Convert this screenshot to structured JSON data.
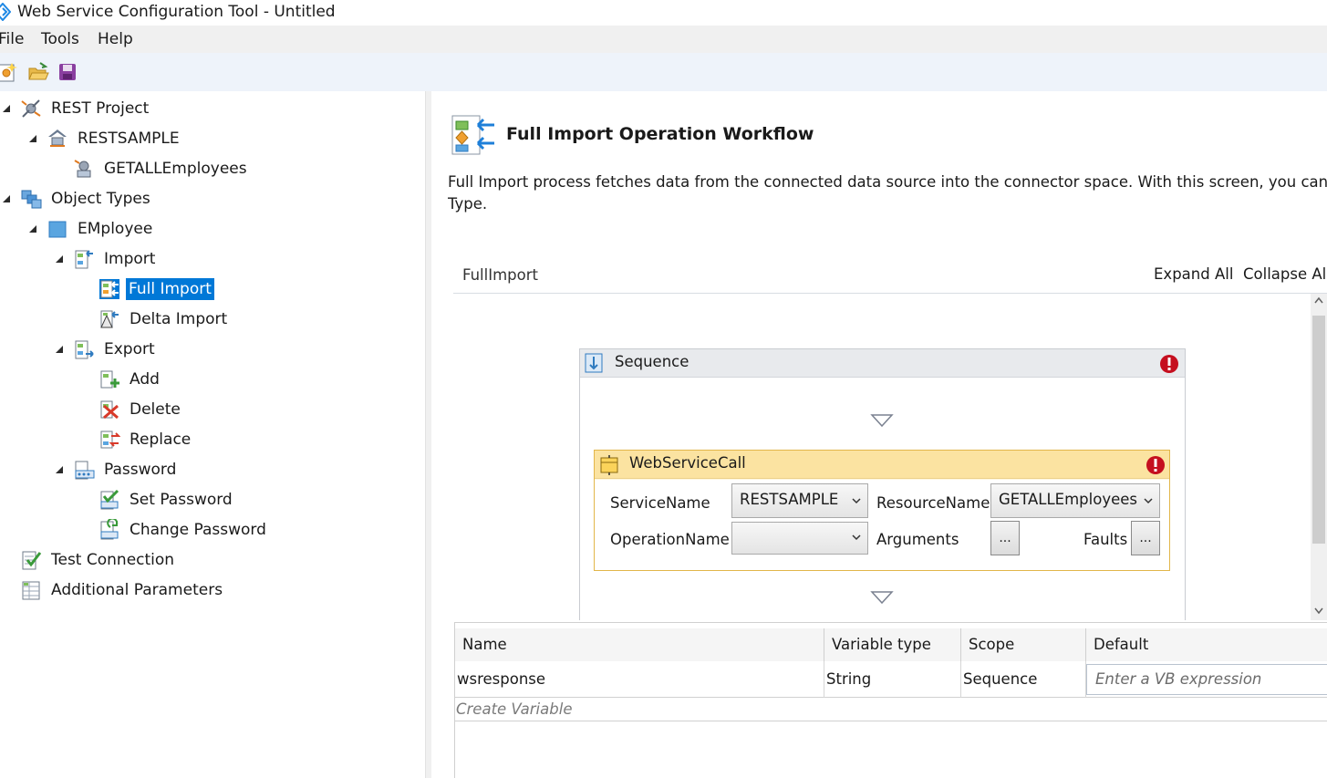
{
  "window": {
    "title": "Web Service Configuration Tool - Untitled"
  },
  "menu": {
    "items": [
      "File",
      "Tools",
      "Help"
    ]
  },
  "toolbar": {
    "buttons": [
      "new-project-icon",
      "open-folder-icon",
      "save-icon"
    ]
  },
  "tree": {
    "nodes": [
      {
        "label": "REST Project",
        "icon": "project-icon",
        "expanded": true
      },
      {
        "label": "RESTSAMPLE",
        "icon": "service-icon",
        "expanded": true
      },
      {
        "label": "GETALLEmployees",
        "icon": "resource-icon"
      },
      {
        "label": "Object Types",
        "icon": "object-types-icon",
        "expanded": true
      },
      {
        "label": "EMployee",
        "icon": "object-type-icon",
        "expanded": true
      },
      {
        "label": "Import",
        "icon": "import-icon",
        "expanded": true
      },
      {
        "label": "Full Import",
        "icon": "full-import-icon",
        "selected": true
      },
      {
        "label": "Delta Import",
        "icon": "delta-import-icon"
      },
      {
        "label": "Export",
        "icon": "export-icon",
        "expanded": true
      },
      {
        "label": "Add",
        "icon": "add-icon"
      },
      {
        "label": "Delete",
        "icon": "delete-icon"
      },
      {
        "label": "Replace",
        "icon": "replace-icon"
      },
      {
        "label": "Password",
        "icon": "password-icon",
        "expanded": true
      },
      {
        "label": "Set Password",
        "icon": "set-password-icon"
      },
      {
        "label": "Change Password",
        "icon": "change-password-icon"
      },
      {
        "label": "Test Connection",
        "icon": "test-connection-icon"
      },
      {
        "label": "Additional Parameters",
        "icon": "parameters-icon"
      }
    ]
  },
  "main": {
    "title": "Full Import Operation Workflow",
    "description_line1": "Full Import process fetches data from the connected data source into the connector space. With this screen, you can confi",
    "description_line2": "Type.",
    "breadcrumb": "FullImport",
    "expand_all": "Expand All",
    "collapse_all": "Collapse All"
  },
  "workflow": {
    "sequence_label": "Sequence",
    "activity": {
      "label": "WebServiceCall",
      "service_name_label": "ServiceName",
      "service_name_value": "RESTSAMPLE",
      "resource_name_label": "ResourceName",
      "resource_name_value": "GETALLEmployees",
      "operation_name_label": "OperationName",
      "operation_name_value": "",
      "arguments_label": "Arguments",
      "arguments_button": "...",
      "faults_label": "Faults",
      "faults_button": "..."
    }
  },
  "variables": {
    "columns": [
      "Name",
      "Variable type",
      "Scope",
      "Default"
    ],
    "rows": [
      {
        "name": "wsresponse",
        "type": "String",
        "scope": "Sequence",
        "default_placeholder": "Enter a VB expression"
      }
    ],
    "create_label": "Create Variable"
  },
  "colors": {
    "selection": "#0078d7",
    "toolbar_bg": "#eef3fa",
    "activity_header": "#fbe3a1",
    "activity_border": "#e2b64a",
    "error_red": "#c50f1f"
  }
}
